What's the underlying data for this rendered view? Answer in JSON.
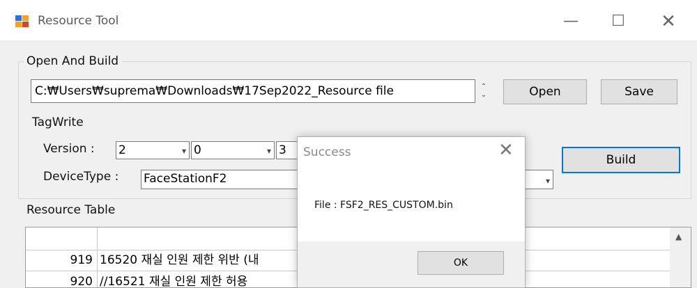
{
  "window": {
    "title": "Resource Tool",
    "icon": "app-icon",
    "controls": {
      "minimize": "—",
      "maximize": "☐",
      "close": "✕"
    }
  },
  "open_build": {
    "group_label": "Open And Build",
    "path_value": "C:₩Users₩suprema₩Downloads₩17Sep2022_Resource file",
    "open_label": "Open",
    "save_label": "Save"
  },
  "tagwrite": {
    "label": "TagWrite",
    "version_label": "Version :",
    "version_major": "2",
    "version_minor": "0",
    "version_patch": "3",
    "device_type_label": "DeviceType :",
    "device_type_value": "FaceStationF2",
    "build_label": "Build"
  },
  "resource_table": {
    "group_label": "Resource Table",
    "rows": [
      {
        "id": "919",
        "text": "16520 재실 인원 제한 위반 (내"
      },
      {
        "id": "920",
        "text": "//16521 재실 인원 제한 허용"
      }
    ]
  },
  "dialog": {
    "title": "Success",
    "close": "✕",
    "message": "File : FSF2_RES_CUSTOM.bin",
    "ok_label": "OK"
  },
  "colors": {
    "accent": "#0078d7",
    "background": "#f0f0f0"
  }
}
